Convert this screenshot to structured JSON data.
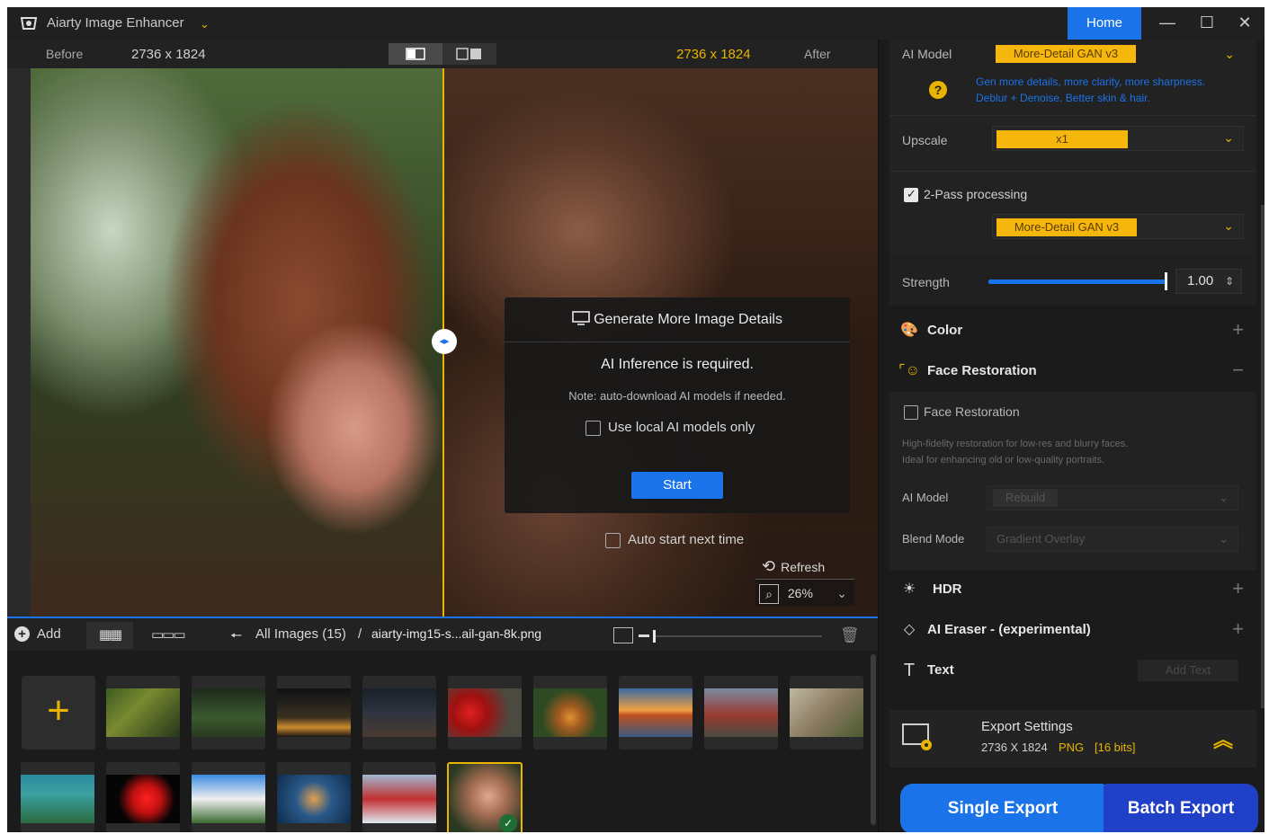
{
  "titlebar": {
    "app_title": "Aiarty Image Enhancer",
    "home": "Home",
    "minimize": "—",
    "maximize": "☐",
    "close": "✕"
  },
  "viewer": {
    "before_label": "Before",
    "before_size": "2736 x 1824",
    "after_size": "2736 x 1824",
    "after_label": "After"
  },
  "dialog": {
    "title": "Generate More Image Details",
    "line1": "AI Inference is required.",
    "note": "Note: auto-download AI models if needed.",
    "local_only": "Use local AI models only",
    "start": "Start",
    "auto_start": "Auto start next time"
  },
  "view_controls": {
    "refresh": "Refresh",
    "zoom": "26%"
  },
  "bottom_bar": {
    "add": "Add",
    "all_images": "All Images (15)",
    "separator": "/",
    "file_name": "aiarty-img15-s...ail-gan-8k.png",
    "thumb_size": 0.02
  },
  "panel": {
    "ai_model_label": "AI Model",
    "ai_model_value": "More-Detail GAN  v3",
    "ai_model_desc1": "Gen more details, more clarity, more sharpness.",
    "ai_model_desc2": "Deblur + Denoise. Better skin & hair.",
    "upscale_label": "Upscale",
    "upscale_value": "x1",
    "two_pass_label": "2-Pass processing",
    "two_pass_model": "More-Detail GAN  v3",
    "strength_label": "Strength",
    "strength_value": "1.00",
    "color": "Color",
    "face_restoration": "Face Restoration",
    "face_checkbox": "Face Restoration",
    "face_desc1": "High-fidelity restoration for low-res and blurry faces.",
    "face_desc2": "Ideal for enhancing old or low-quality portraits.",
    "face_model_label": "AI Model",
    "face_model_value": "Rebuild",
    "blend_label": "Blend Mode",
    "blend_value": "Gradient Overlay",
    "hdr": "HDR",
    "ai_eraser": "AI Eraser - (experimental)",
    "text": "Text",
    "add_text": "Add Text",
    "export_title": "Export Settings",
    "export_size": "2736 X 1824",
    "export_format": "PNG",
    "export_bits": "[16 bits]",
    "single_export": "Single Export",
    "batch_export": "Batch Export"
  },
  "colors": {
    "accent_blue": "#1a73e8",
    "accent_yellow": "#e8b400",
    "bg": "#1b1b1b"
  }
}
